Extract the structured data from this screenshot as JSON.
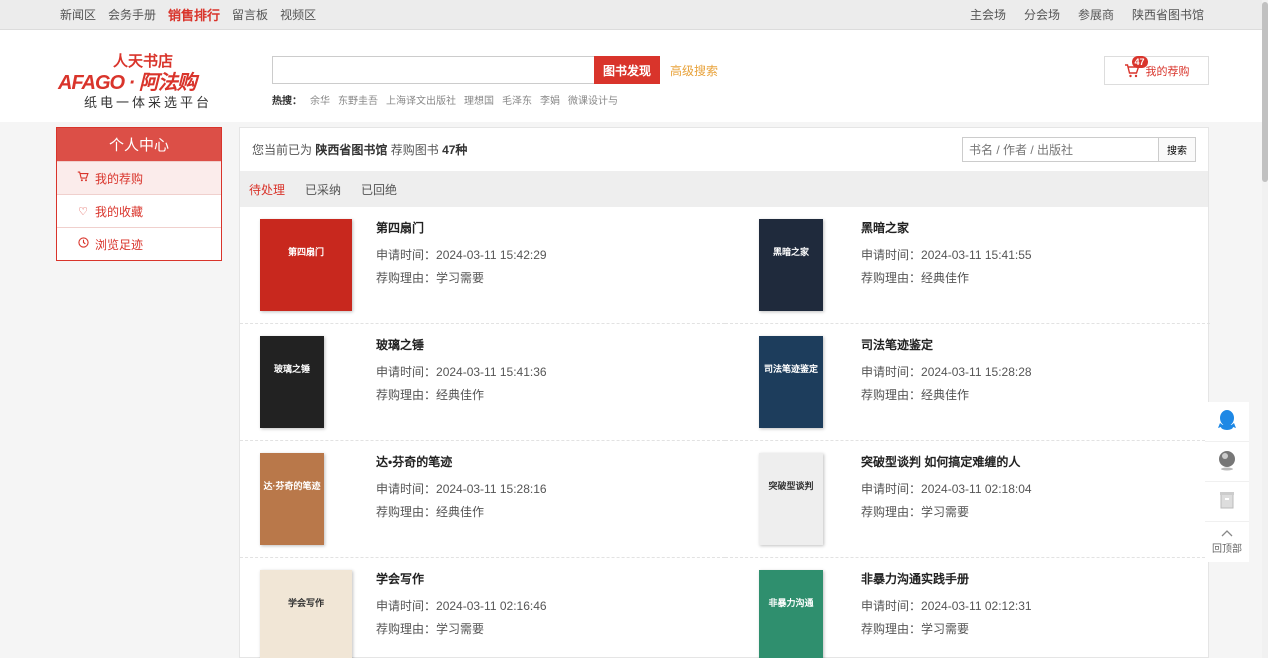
{
  "topbar": {
    "left_links": [
      "新闻区",
      "会务手册",
      "销售排行",
      "留言板",
      "视频区"
    ],
    "right_links": [
      "主会场",
      "分会场",
      "参展商",
      "陕西省图书馆"
    ]
  },
  "logo": {
    "line1": "人天书店",
    "line2": "AFAGO · 阿法购",
    "line3": "纸电一体采选平台"
  },
  "search": {
    "placeholder": "",
    "button": "图书发现",
    "advanced": "高级搜索",
    "hot_label": "热搜：",
    "hot_words": [
      "余华",
      "东野圭吾",
      "上海译文出版社",
      "理想国",
      "毛泽东",
      "李娟",
      "微课设计与"
    ]
  },
  "cart": {
    "count": "47",
    "label": "我的荐购"
  },
  "sidebar": {
    "title": "个人中心",
    "items": [
      {
        "label": "我的荐购",
        "icon": "cart-icon"
      },
      {
        "label": "我的收藏",
        "icon": "heart-icon"
      },
      {
        "label": "浏览足迹",
        "icon": "clock-icon"
      }
    ]
  },
  "main": {
    "info_prefix": "您当前已为",
    "library": "陕西省图书馆",
    "info_mid": "荐购图书",
    "count": "47种",
    "filter_placeholder": "书名 / 作者 / 出版社",
    "filter_button": "搜索",
    "tabs": [
      "待处理",
      "已采纳",
      "已回绝"
    ]
  },
  "books": [
    {
      "title": "第四扇门",
      "time_label": "申请时间：",
      "time": "2024-03-11 15:42:29",
      "reason_label": "荐购理由：",
      "reason": "学习需要",
      "cover_color": "#c8281e",
      "cover_text": "第四扇门"
    },
    {
      "title": "黑暗之家",
      "time_label": "申请时间：",
      "time": "2024-03-11 15:41:55",
      "reason_label": "荐购理由：",
      "reason": "经典佳作",
      "cover_color": "#1f2a3c",
      "cover_text": "黑暗之家"
    },
    {
      "title": "玻璃之锤",
      "time_label": "申请时间：",
      "time": "2024-03-11 15:41:36",
      "reason_label": "荐购理由：",
      "reason": "经典佳作",
      "cover_color": "#222222",
      "cover_text": "玻璃之锤"
    },
    {
      "title": "司法笔迹鉴定",
      "time_label": "申请时间：",
      "time": "2024-03-11 15:28:28",
      "reason_label": "荐购理由：",
      "reason": "经典佳作",
      "cover_color": "#1d3d5c",
      "cover_text": "司法笔迹鉴定"
    },
    {
      "title": "达•芬奇的笔迹",
      "time_label": "申请时间：",
      "time": "2024-03-11 15:28:16",
      "reason_label": "荐购理由：",
      "reason": "经典佳作",
      "cover_color": "#b9784a",
      "cover_text": "达·芬奇的笔迹"
    },
    {
      "title": "突破型谈判 如何搞定难缠的人",
      "time_label": "申请时间：",
      "time": "2024-03-11 02:18:04",
      "reason_label": "荐购理由：",
      "reason": "学习需要",
      "cover_color": "#eeeeee",
      "cover_text": "突破型谈判"
    },
    {
      "title": "学会写作",
      "time_label": "申请时间：",
      "time": "2024-03-11 02:16:46",
      "reason_label": "荐购理由：",
      "reason": "学习需要",
      "cover_color": "#f1e6d6",
      "cover_text": "学会写作"
    },
    {
      "title": "非暴力沟通实践手册",
      "time_label": "申请时间：",
      "time": "2024-03-11 02:12:31",
      "reason_label": "荐购理由：",
      "reason": "学习需要",
      "cover_color": "#2f8f6e",
      "cover_text": "非暴力沟通"
    }
  ],
  "floatbar": {
    "top_label": "回顶部"
  }
}
